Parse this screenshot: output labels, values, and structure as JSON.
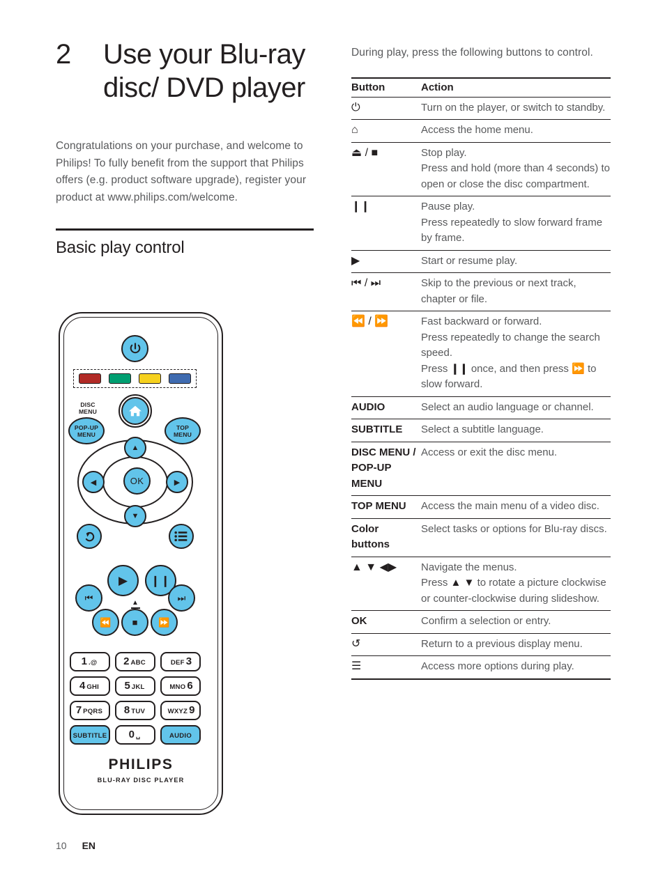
{
  "chapter": {
    "number": "2",
    "title": "Use your Blu-ray disc/ DVD player"
  },
  "intro_left": "Congratulations on your purchase, and welcome to Philips! To fully benefit from the support that Philips offers (e.g. product software upgrade), register your product at www.philips.com/welcome.",
  "section": {
    "title": "Basic play control"
  },
  "intro_right": "During play, press the following buttons to control.",
  "table": {
    "headers": [
      "Button",
      "Action"
    ],
    "rows": [
      {
        "button": "⏻",
        "button_kind": "glyph",
        "action": "Turn on the player, or switch to standby."
      },
      {
        "button": "⌂",
        "button_kind": "glyph",
        "action": "Access the home menu."
      },
      {
        "button": "⏏ / ■",
        "button_kind": "glyph",
        "action": "Stop play.\nPress and hold (more than 4 seconds) to open or close the disc compartment."
      },
      {
        "button": "❙❙",
        "button_kind": "glyph",
        "action": "Pause play.\nPress repeatedly to slow forward frame by frame."
      },
      {
        "button": "▶",
        "button_kind": "glyph",
        "action": "Start or resume play."
      },
      {
        "button": "⏮ / ⏭",
        "button_kind": "glyph",
        "action": "Skip to the previous or next track, chapter or file."
      },
      {
        "button": "⏪ / ⏩",
        "button_kind": "glyph",
        "action": "Fast backward or forward.\nPress repeatedly to change the search speed.\nPress ❙❙ once, and then press ⏩ to slow forward."
      },
      {
        "button": "AUDIO",
        "button_kind": "text",
        "action": "Select an audio language or channel."
      },
      {
        "button": "SUBTITLE",
        "button_kind": "text",
        "action": "Select a subtitle language."
      },
      {
        "button": "DISC MENU / POP-UP MENU",
        "button_kind": "text",
        "action": "Access or exit the disc menu."
      },
      {
        "button": "TOP MENU",
        "button_kind": "text",
        "action": "Access the main menu of a video disc."
      },
      {
        "button": "Color buttons",
        "button_kind": "text",
        "action": "Select tasks or options for Blu-ray discs."
      },
      {
        "button": "▲ ▼ ◀▶",
        "button_kind": "glyph",
        "action": "Navigate the menus.\nPress ▲ ▼ to rotate a picture clockwise or counter-clockwise during slideshow."
      },
      {
        "button": "OK",
        "button_kind": "text",
        "action": "Confirm a selection or entry."
      },
      {
        "button": "↺",
        "button_kind": "glyph",
        "action": "Return to a previous display menu."
      },
      {
        "button": "☰",
        "button_kind": "glyph",
        "action": "Access more options during play."
      }
    ]
  },
  "remote": {
    "brand": "PHILIPS",
    "brand_sub": "BLU-RAY DISC PLAYER",
    "power_label": "⏻",
    "color_buttons": [
      {
        "name": "red",
        "hex": "#b12a26"
      },
      {
        "name": "green",
        "hex": "#009f71"
      },
      {
        "name": "yellow",
        "hex": "#f6d11e"
      },
      {
        "name": "blue",
        "hex": "#3f6bb0"
      }
    ],
    "home_label": "⌂",
    "disc_menu_label_line1": "DISC",
    "disc_menu_label_line2": "MENU",
    "popup_line1": "POP-UP",
    "popup_line2": "MENU",
    "top_menu_line1": "TOP",
    "top_menu_line2": "MENU",
    "nav_up": "▲",
    "nav_down": "▼",
    "nav_left": "◀",
    "nav_right": "▶",
    "ok_label": "OK",
    "back_label": "↺",
    "options_label": "☰",
    "play_label": "▶",
    "pause_label": "❙❙",
    "prev_label": "⏮",
    "next_label": "⏭",
    "rewind_label": "⏪",
    "forward_label": "⏩",
    "stop_label": "■",
    "eject_label": "▲",
    "keypad": [
      {
        "digit": "1",
        "letters": ".@",
        "digit_first": true,
        "highlight": false
      },
      {
        "digit": "2",
        "letters": "ABC",
        "digit_first": true,
        "highlight": false
      },
      {
        "digit": "3",
        "letters": "DEF",
        "digit_first": false,
        "highlight": false
      },
      {
        "digit": "4",
        "letters": "GHI",
        "digit_first": true,
        "highlight": false
      },
      {
        "digit": "5",
        "letters": "JKL",
        "digit_first": true,
        "highlight": false
      },
      {
        "digit": "6",
        "letters": "MNO",
        "digit_first": false,
        "highlight": false
      },
      {
        "digit": "7",
        "letters": "PQRS",
        "digit_first": true,
        "highlight": false
      },
      {
        "digit": "8",
        "letters": "TUV",
        "digit_first": true,
        "highlight": false
      },
      {
        "digit": "9",
        "letters": "WXYZ",
        "digit_first": false,
        "highlight": false
      },
      {
        "digit": "SUBTITLE",
        "letters": "",
        "digit_first": true,
        "highlight": true
      },
      {
        "digit": "0",
        "letters": "␣",
        "digit_first": true,
        "highlight": false
      },
      {
        "digit": "AUDIO",
        "letters": "",
        "digit_first": true,
        "highlight": true
      }
    ]
  },
  "footer": {
    "page": "10",
    "lang": "EN"
  },
  "colors": {
    "button_blue": "#62c4ea",
    "ink": "#231f20",
    "body_text": "#58595b"
  }
}
